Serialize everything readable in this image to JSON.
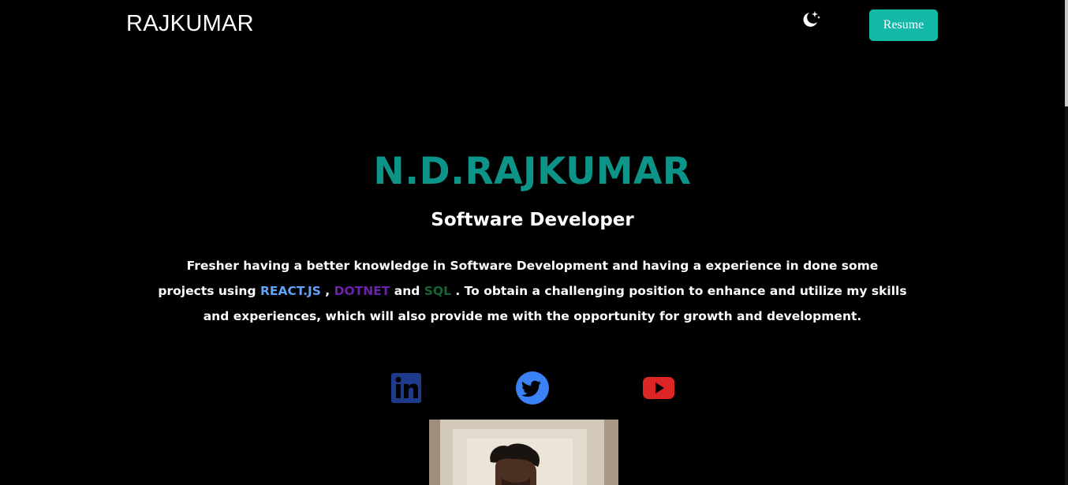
{
  "header": {
    "brand": "RAJKUMAR",
    "theme_toggle_icon": "moon-stars-icon",
    "resume_label": "Resume"
  },
  "hero": {
    "name": "N.D.RAJKUMAR",
    "role": "Software Developer",
    "description": {
      "part1": "Fresher having a better knowledge in Software Development and having a experience in done some projects using ",
      "react": "REACT.JS",
      "sep1": " , ",
      "dotnet": "DOTNET",
      "sep2": " and ",
      "sql": "SQL",
      "part2": " . To obtain a challenging position to enhance and utilize my skills and experiences, which will also provide me with the opportunity for growth and development."
    }
  },
  "socials": [
    {
      "icon": "linkedin-icon",
      "color": "#1e3a8a"
    },
    {
      "icon": "twitter-icon",
      "color": "#3b82f6"
    },
    {
      "icon": "youtube-icon",
      "color": "#dc2626"
    }
  ],
  "colors": {
    "accent": "#0d9488",
    "button": "#14b8a6",
    "react": "#60a5fa",
    "dotnet": "#6b21a8",
    "sql": "#166534",
    "background": "#000000"
  }
}
